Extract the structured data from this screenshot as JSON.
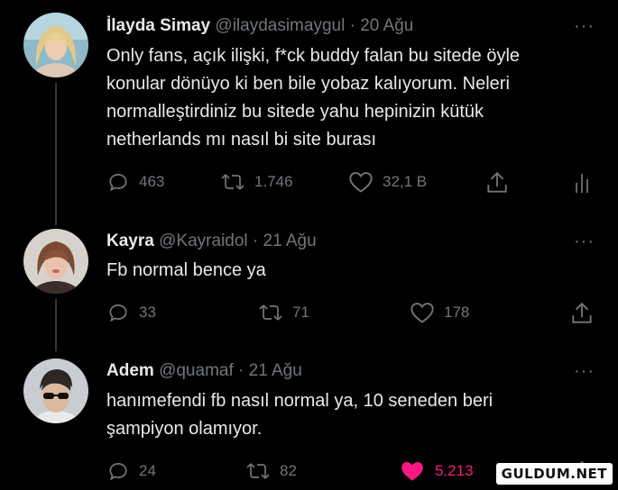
{
  "tweets": [
    {
      "name": "İlayda Simay",
      "handle": "@ilaydasimaygul",
      "date": "20 Ağu",
      "lines": [
        "Only fans, açık ilişki, f*ck buddy falan bu  sitede öyle",
        "konular dönüyo ki ben bile yobaz kalıyorum. Neleri",
        "normalleştirdiniz bu sitede yahu hepinizin kütük",
        "netherlands mı nasıl bi site burası"
      ],
      "replies": "463",
      "retweets": "1.746",
      "likes": "32,1 B"
    },
    {
      "name": "Kayra",
      "handle": "@Kayraidol",
      "date": "21 Ağu",
      "lines": [
        "Fb normal bence ya"
      ],
      "replies": "33",
      "retweets": "71",
      "likes": "178"
    },
    {
      "name": "Adem",
      "handle": "@quamaf",
      "date": "21 Ağu",
      "lines": [
        "hanımefendi fb nasıl normal ya, 10 seneden beri",
        "şampiyon olamıyor."
      ],
      "replies": "24",
      "retweets": "82",
      "likes": "5.213"
    }
  ],
  "dot": "·",
  "more": "···",
  "watermark": "GULDUM.NET",
  "colors": {
    "accent_like": "#f91880",
    "muted": "#71767b",
    "text": "#e7e9ea"
  }
}
